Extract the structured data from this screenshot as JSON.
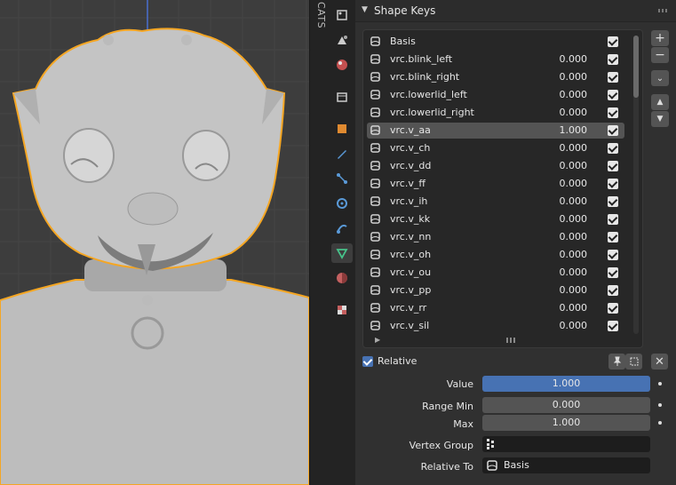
{
  "sidebar_tab_label": "CATS",
  "panel": {
    "title": "Shape Keys",
    "collapse_icon": "chevron-down-icon"
  },
  "shape_keys": [
    {
      "name": "Basis",
      "value": "",
      "checked": true,
      "active": false
    },
    {
      "name": "vrc.blink_left",
      "value": "0.000",
      "checked": true,
      "active": false
    },
    {
      "name": "vrc.blink_right",
      "value": "0.000",
      "checked": true,
      "active": false
    },
    {
      "name": "vrc.lowerlid_left",
      "value": "0.000",
      "checked": true,
      "active": false
    },
    {
      "name": "vrc.lowerlid_right",
      "value": "0.000",
      "checked": true,
      "active": false
    },
    {
      "name": "vrc.v_aa",
      "value": "1.000",
      "checked": true,
      "active": true
    },
    {
      "name": "vrc.v_ch",
      "value": "0.000",
      "checked": true,
      "active": false
    },
    {
      "name": "vrc.v_dd",
      "value": "0.000",
      "checked": true,
      "active": false
    },
    {
      "name": "vrc.v_ff",
      "value": "0.000",
      "checked": true,
      "active": false
    },
    {
      "name": "vrc.v_ih",
      "value": "0.000",
      "checked": true,
      "active": false
    },
    {
      "name": "vrc.v_kk",
      "value": "0.000",
      "checked": true,
      "active": false
    },
    {
      "name": "vrc.v_nn",
      "value": "0.000",
      "checked": true,
      "active": false
    },
    {
      "name": "vrc.v_oh",
      "value": "0.000",
      "checked": true,
      "active": false
    },
    {
      "name": "vrc.v_ou",
      "value": "0.000",
      "checked": true,
      "active": false
    },
    {
      "name": "vrc.v_pp",
      "value": "0.000",
      "checked": true,
      "active": false
    },
    {
      "name": "vrc.v_rr",
      "value": "0.000",
      "checked": true,
      "active": false
    },
    {
      "name": "vrc.v_sil",
      "value": "0.000",
      "checked": true,
      "active": false
    }
  ],
  "side_buttons": {
    "add": "+",
    "remove": "−",
    "up": "▲",
    "down": "▼"
  },
  "relative": {
    "label": "Relative",
    "checked": true
  },
  "properties": {
    "value_label": "Value",
    "value": "1.000",
    "range_min_label": "Range Min",
    "range_min": "0.000",
    "max_label": "Max",
    "max": "1.000",
    "vertex_group_label": "Vertex Group",
    "vertex_group": "",
    "relative_to_label": "Relative To",
    "relative_to": "Basis"
  },
  "colors": {
    "accent_blue": "#4772b3",
    "selection_outline": "#f5a623",
    "panel_bg": "#303030",
    "viewport_bg": "#3d3d3d"
  }
}
